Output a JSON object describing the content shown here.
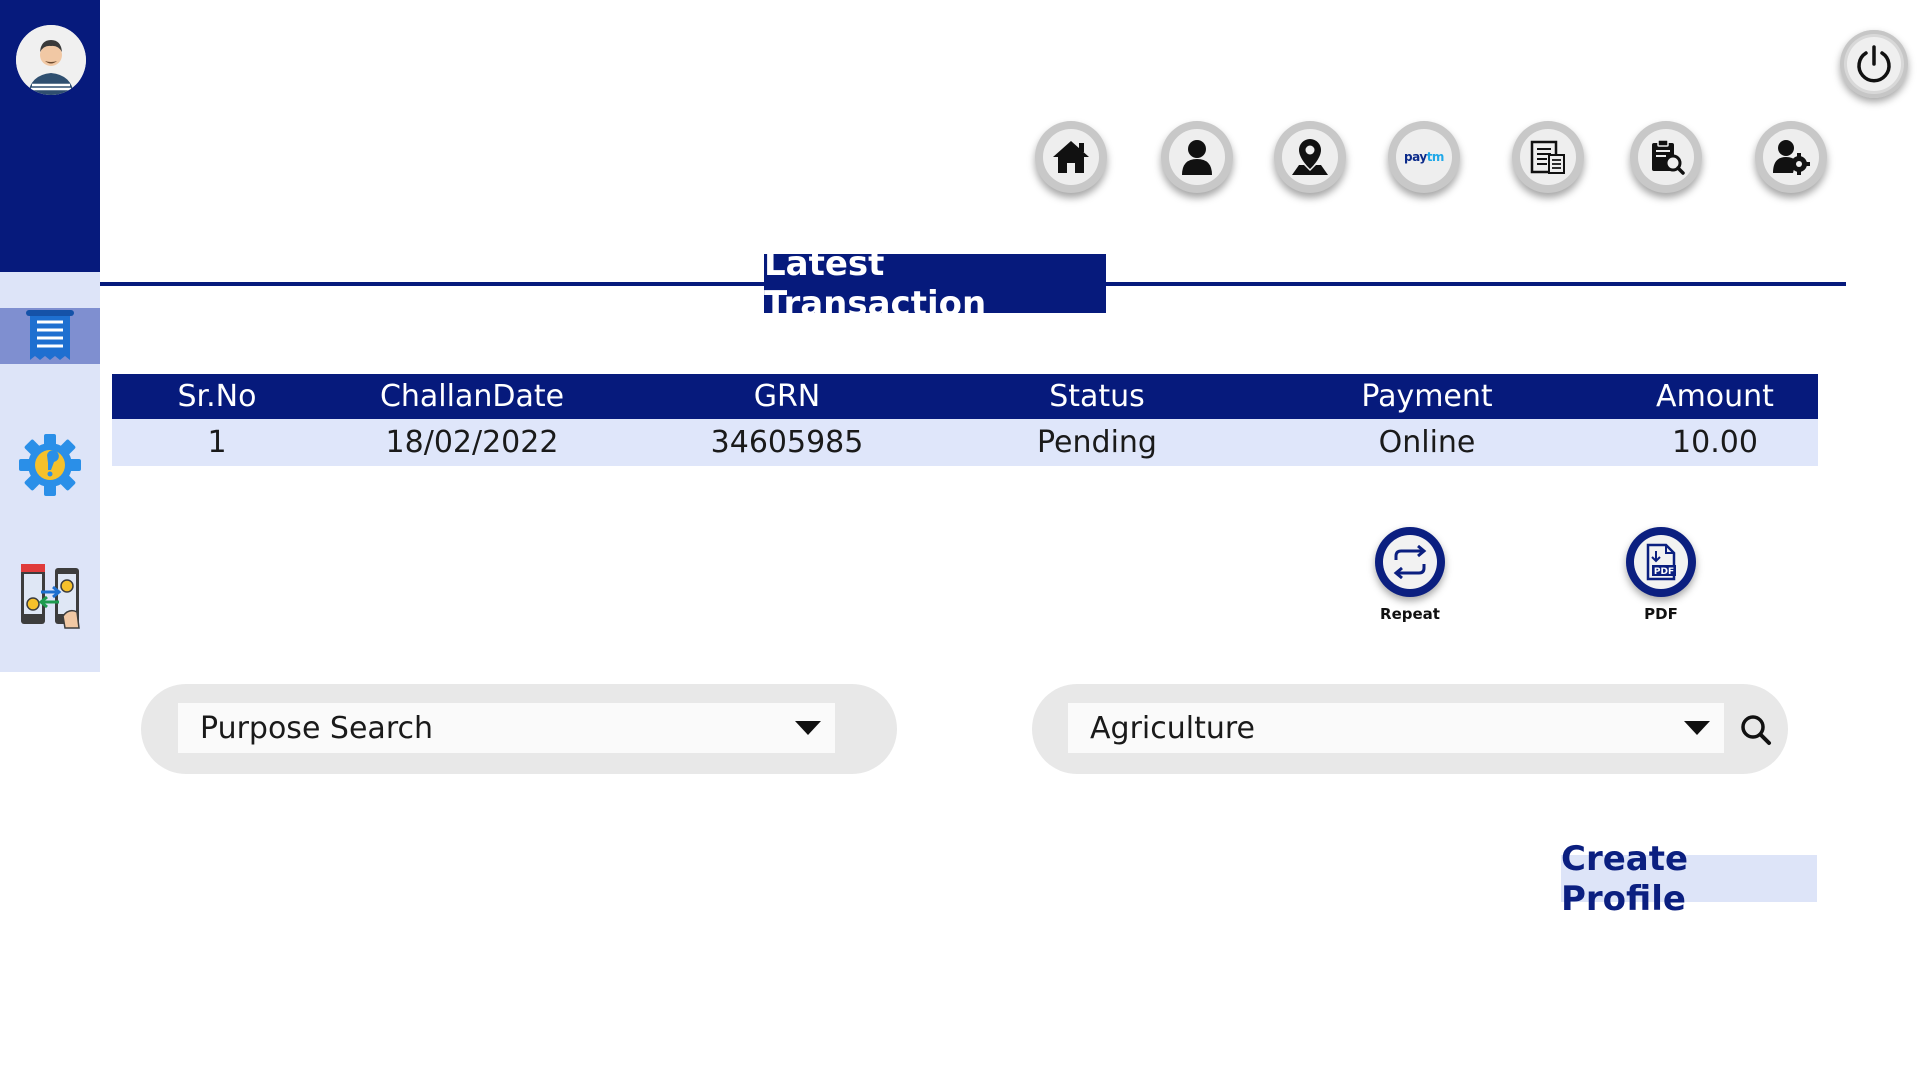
{
  "title": "Latest Transaction",
  "table": {
    "headers": [
      "Sr.No",
      "ChallanDate",
      "GRN",
      "Status",
      "Payment",
      "Amount"
    ],
    "rows": [
      {
        "sr_no": "1",
        "challan_date": "18/02/2022",
        "grn": "34605985",
        "status": "Pending",
        "payment": "Online",
        "amount": "10.00"
      }
    ]
  },
  "actions": {
    "repeat_label": "Repeat",
    "pdf_label": "PDF"
  },
  "purpose_search": {
    "value": "Purpose Search"
  },
  "category_search": {
    "value": "Agriculture"
  },
  "create_profile_label": "Create Profile",
  "nav_icons": [
    "home-icon",
    "user-icon",
    "map-pin-icon",
    "paytm-icon",
    "receipt-icon",
    "search-document-icon",
    "user-settings-icon"
  ],
  "sidebar_icons": [
    "avatar",
    "receipt-list-icon",
    "settings-gear-icon",
    "mobile-transfer-icon"
  ],
  "colors": {
    "brand_navy": "#061a7c",
    "sidebar_light": "#dde4f8",
    "row_light": "#dfe6fa"
  }
}
